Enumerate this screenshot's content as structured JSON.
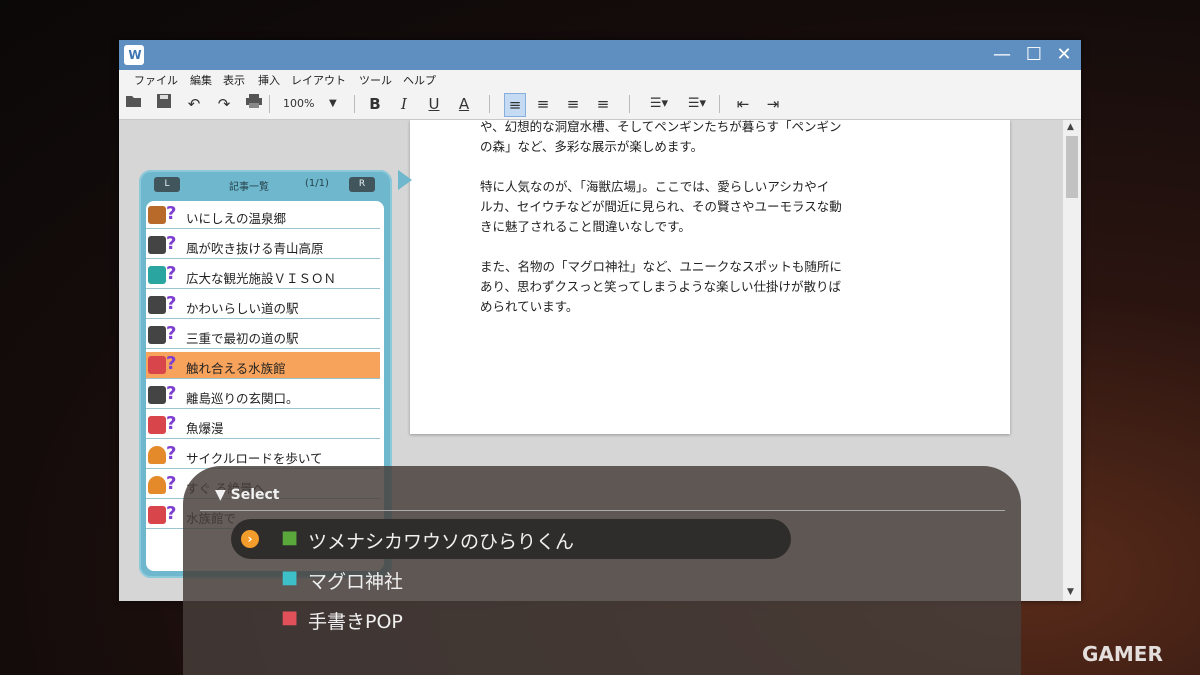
{
  "window": {
    "app_icon_text": "W",
    "controls": {
      "minimize": "—",
      "maximize": "☐",
      "close": "✕"
    }
  },
  "menu": [
    "ファイル",
    "編集",
    "表示",
    "挿入",
    "レイアウト",
    "ツール",
    "ヘルプ"
  ],
  "toolbar": {
    "zoom_value": "100%",
    "bold": "B",
    "italic": "I",
    "underline": "U",
    "font_color": "A"
  },
  "document": {
    "paragraphs": [
      [
        "や、幻想的な洞窟水槽、そしてペンギンたちが暮らす「ペンギン",
        "の森」など、多彩な展示が楽しめます。"
      ],
      [
        "特に人気なのが、「海獣広場」。ここでは、愛らしいアシカやイ",
        "ルカ、セイウチなどが間近に見られ、その賢さやユーモラスな動",
        "きに魅了されること間違いなしです。"
      ],
      [
        "また、名物の「マグロ神社」など、ユニークなスポットも随所に",
        "あり、思わずクスっと笑ってしまうような楽しい仕掛けが散りば",
        "められています。"
      ]
    ]
  },
  "article_panel": {
    "left_button": "L",
    "right_button": "R",
    "title": "記事一覧",
    "count": "(1/1)",
    "items": [
      {
        "icon": "onsen-icon",
        "label": "いにしえの温泉郷"
      },
      {
        "icon": "book-icon",
        "label": "風が吹き抜ける青山高原"
      },
      {
        "icon": "cutlery-icon",
        "label": "広大な観光施設ＶＩＳＯＮ"
      },
      {
        "icon": "book-icon",
        "label": "かわいらしい道の駅"
      },
      {
        "icon": "book-icon",
        "label": "三重で最初の道の駅"
      },
      {
        "icon": "gamepad-icon",
        "label": "触れ合える水族館"
      },
      {
        "icon": "book-icon",
        "label": "離島巡りの玄関口。"
      },
      {
        "icon": "gamepad-icon",
        "label": "魚爆漫"
      },
      {
        "icon": "person-icon",
        "label": "サイクルロードを歩いて"
      },
      {
        "icon": "person-icon",
        "label": "すぐ             る絶景へ"
      },
      {
        "icon": "gamepad-icon",
        "label": "水族館で"
      }
    ],
    "question_mark": "?"
  },
  "select": {
    "label": "▼ Select",
    "choices": [
      {
        "icon": "tree-icon",
        "label": "ツメナシカワウソのひらりくん",
        "highlighted": true
      },
      {
        "icon": "cutlery-icon",
        "label": "マグロ神社",
        "highlighted": false
      },
      {
        "icon": "gamepad-icon",
        "label": "手書きPOP",
        "highlighted": false
      }
    ],
    "cursor_glyph": "›"
  },
  "watermark": "GAMER",
  "colors": {
    "titlebar": "#5f8fc1",
    "panel": "#6fb7cc",
    "selected_item": "#f7a35c",
    "question": "#7d3fd1",
    "cursor": "#f29c2b"
  }
}
